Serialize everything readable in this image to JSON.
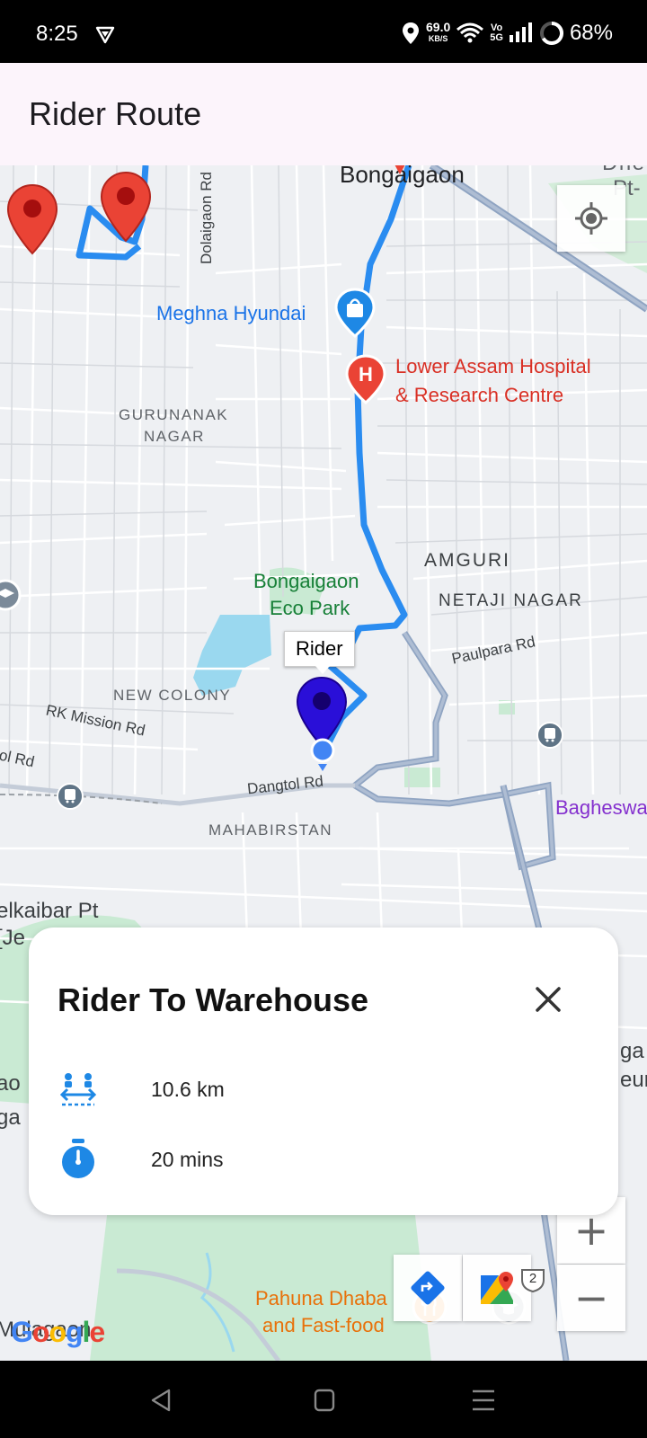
{
  "status_bar": {
    "time": "8:25",
    "network_speed": "69.0",
    "network_speed_unit": "KB/S",
    "volte_top": "Vo",
    "volte_bottom": "5G",
    "battery": "68%"
  },
  "app_bar": {
    "title": "Rider Route"
  },
  "map": {
    "labels": {
      "city": "Bongaigaon",
      "city_edge_top": "Dhe",
      "city_edge_pt": "Pt-",
      "dolaigaon_rd": "Dolaigaon Rd",
      "meghna_hyundai": "Meghna Hyundai",
      "hospital_line1": "Lower Assam Hospital",
      "hospital_line2": "& Research Centre",
      "gurunanak_line1": "GURUNANAK",
      "gurunanak_line2": "NAGAR",
      "amguri": "AMGURI",
      "netaji_nagar": "NETAJI NAGAR",
      "eco_park_line1": "Bongaigaon",
      "eco_park_line2": "Eco Park",
      "paulpara_rd": "Paulpara Rd",
      "new_colony": "NEW COLONY",
      "rk_mission_rd": "RK Mission Rd",
      "tol_rd": "tol Rd",
      "dangtol_rd": "Dangtol Rd",
      "mahabirstan": "MAHABIRSTAN",
      "bagheswari": "Bagheswa",
      "left_edge_1": "elkaibar Pt",
      "left_edge_2": "[Je",
      "left_edge_3": "ao",
      "left_edge_4": "ga",
      "right_edge_1": "ga",
      "right_edge_2": "eur",
      "pahuna_line1": "Pahuna Dhaba",
      "pahuna_line2": "and Fast-food",
      "mulagaon": "Mulagaon",
      "highway_number": "2"
    },
    "rider_marker_label": "Rider",
    "google_logo": "Google",
    "colors": {
      "route": "#2a8cf0",
      "marker_red": "#ea4335",
      "marker_rider": "#2a0fd8",
      "water": "#9ad8ef",
      "park": "#c9ead3"
    }
  },
  "route_card": {
    "title": "Rider To Warehouse",
    "distance": "10.6 km",
    "duration": "20 mins"
  }
}
